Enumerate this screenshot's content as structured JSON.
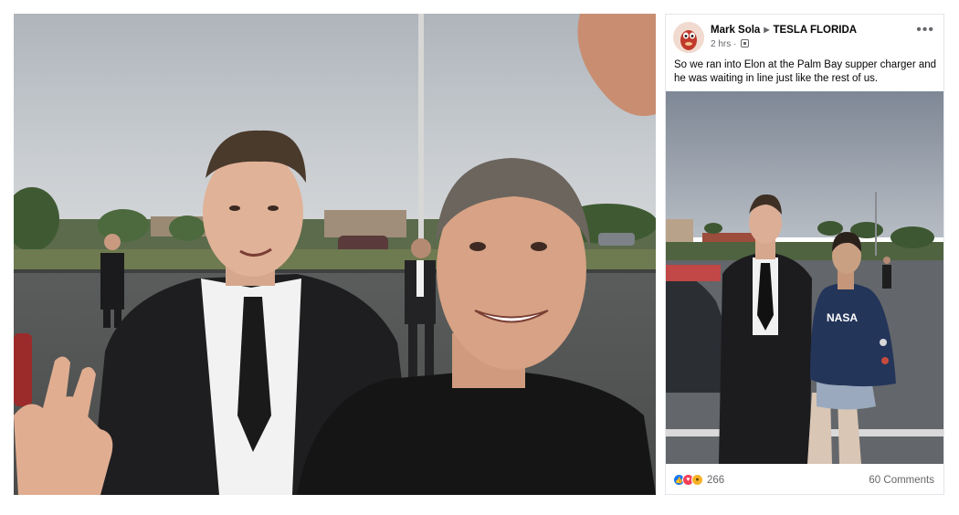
{
  "post": {
    "author": "Mark Sola",
    "group": "TESLA FLORIDA",
    "time": "2 hrs",
    "separator": "·",
    "more_icon": "•••",
    "text": "So we ran into Elon at the Palm Bay supper charger and he was waiting in line just like the rest of us.",
    "reaction_count": "266",
    "comments_label": "60 Comments"
  },
  "icons": {
    "more": "ellipsis-icon",
    "privacy": "privacy-icon",
    "arrow": "triangle-right-icon",
    "reactions": [
      "like-icon",
      "love-icon",
      "wow-icon"
    ]
  },
  "colors": {
    "facebook_blue": "#1877f2",
    "love_red": "#f33e58",
    "wow_yellow": "#f7b125",
    "secondary_text": "#65676b"
  }
}
